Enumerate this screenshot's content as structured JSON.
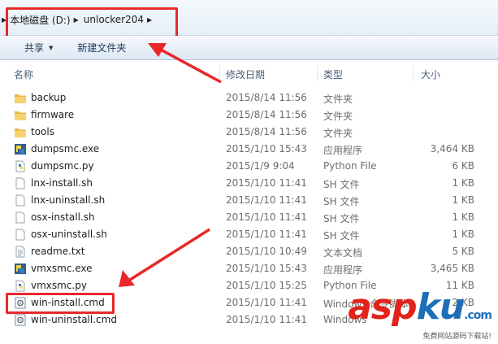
{
  "address": {
    "segments": [
      "本地磁盘 (D:)",
      "unlocker204"
    ]
  },
  "toolbar": {
    "share_label": "共享",
    "new_folder_label": "新建文件夹"
  },
  "columns": {
    "name": "名称",
    "modified": "修改日期",
    "type": "类型",
    "size": "大小"
  },
  "files": [
    {
      "name": "backup",
      "modified": "2015/8/14 11:56",
      "type": "文件夹",
      "size": "",
      "icon": "folder-icon"
    },
    {
      "name": "firmware",
      "modified": "2015/8/14 11:56",
      "type": "文件夹",
      "size": "",
      "icon": "folder-icon"
    },
    {
      "name": "tools",
      "modified": "2015/8/14 11:56",
      "type": "文件夹",
      "size": "",
      "icon": "folder-icon"
    },
    {
      "name": "dumpsmc.exe",
      "modified": "2015/1/10 15:43",
      "type": "应用程序",
      "size": "3,464 KB",
      "icon": "python-exe-icon"
    },
    {
      "name": "dumpsmc.py",
      "modified": "2015/1/9 9:04",
      "type": "Python File",
      "size": "6 KB",
      "icon": "python-file-icon"
    },
    {
      "name": "lnx-install.sh",
      "modified": "2015/1/10 11:41",
      "type": "SH 文件",
      "size": "1 KB",
      "icon": "document-icon"
    },
    {
      "name": "lnx-uninstall.sh",
      "modified": "2015/1/10 11:41",
      "type": "SH 文件",
      "size": "1 KB",
      "icon": "document-icon"
    },
    {
      "name": "osx-install.sh",
      "modified": "2015/1/10 11:41",
      "type": "SH 文件",
      "size": "1 KB",
      "icon": "document-icon"
    },
    {
      "name": "osx-uninstall.sh",
      "modified": "2015/1/10 11:41",
      "type": "SH 文件",
      "size": "1 KB",
      "icon": "document-icon"
    },
    {
      "name": "readme.txt",
      "modified": "2015/1/10 10:49",
      "type": "文本文档",
      "size": "5 KB",
      "icon": "text-document-icon"
    },
    {
      "name": "vmxsmc.exe",
      "modified": "2015/1/10 15:43",
      "type": "应用程序",
      "size": "3,465 KB",
      "icon": "python-exe-icon"
    },
    {
      "name": "vmxsmc.py",
      "modified": "2015/1/10 15:25",
      "type": "Python File",
      "size": "11 KB",
      "icon": "python-file-icon"
    },
    {
      "name": "win-install.cmd",
      "modified": "2015/1/10 11:41",
      "type": "Windows 命令脚本",
      "size": "2 KB",
      "icon": "cmd-script-icon"
    },
    {
      "name": "win-uninstall.cmd",
      "modified": "2015/1/10 11:41",
      "type": "Windows",
      "size": "",
      "icon": "cmd-script-icon"
    }
  ],
  "watermark": {
    "big_a": "asp",
    "big_b": "ku",
    "dotcom": ".com",
    "tagline": "免费网站源码下载站!"
  },
  "colors": {
    "annotation_red": "#e8282b",
    "watermark_red": "#e2231a",
    "watermark_blue": "#1d6fb8"
  }
}
